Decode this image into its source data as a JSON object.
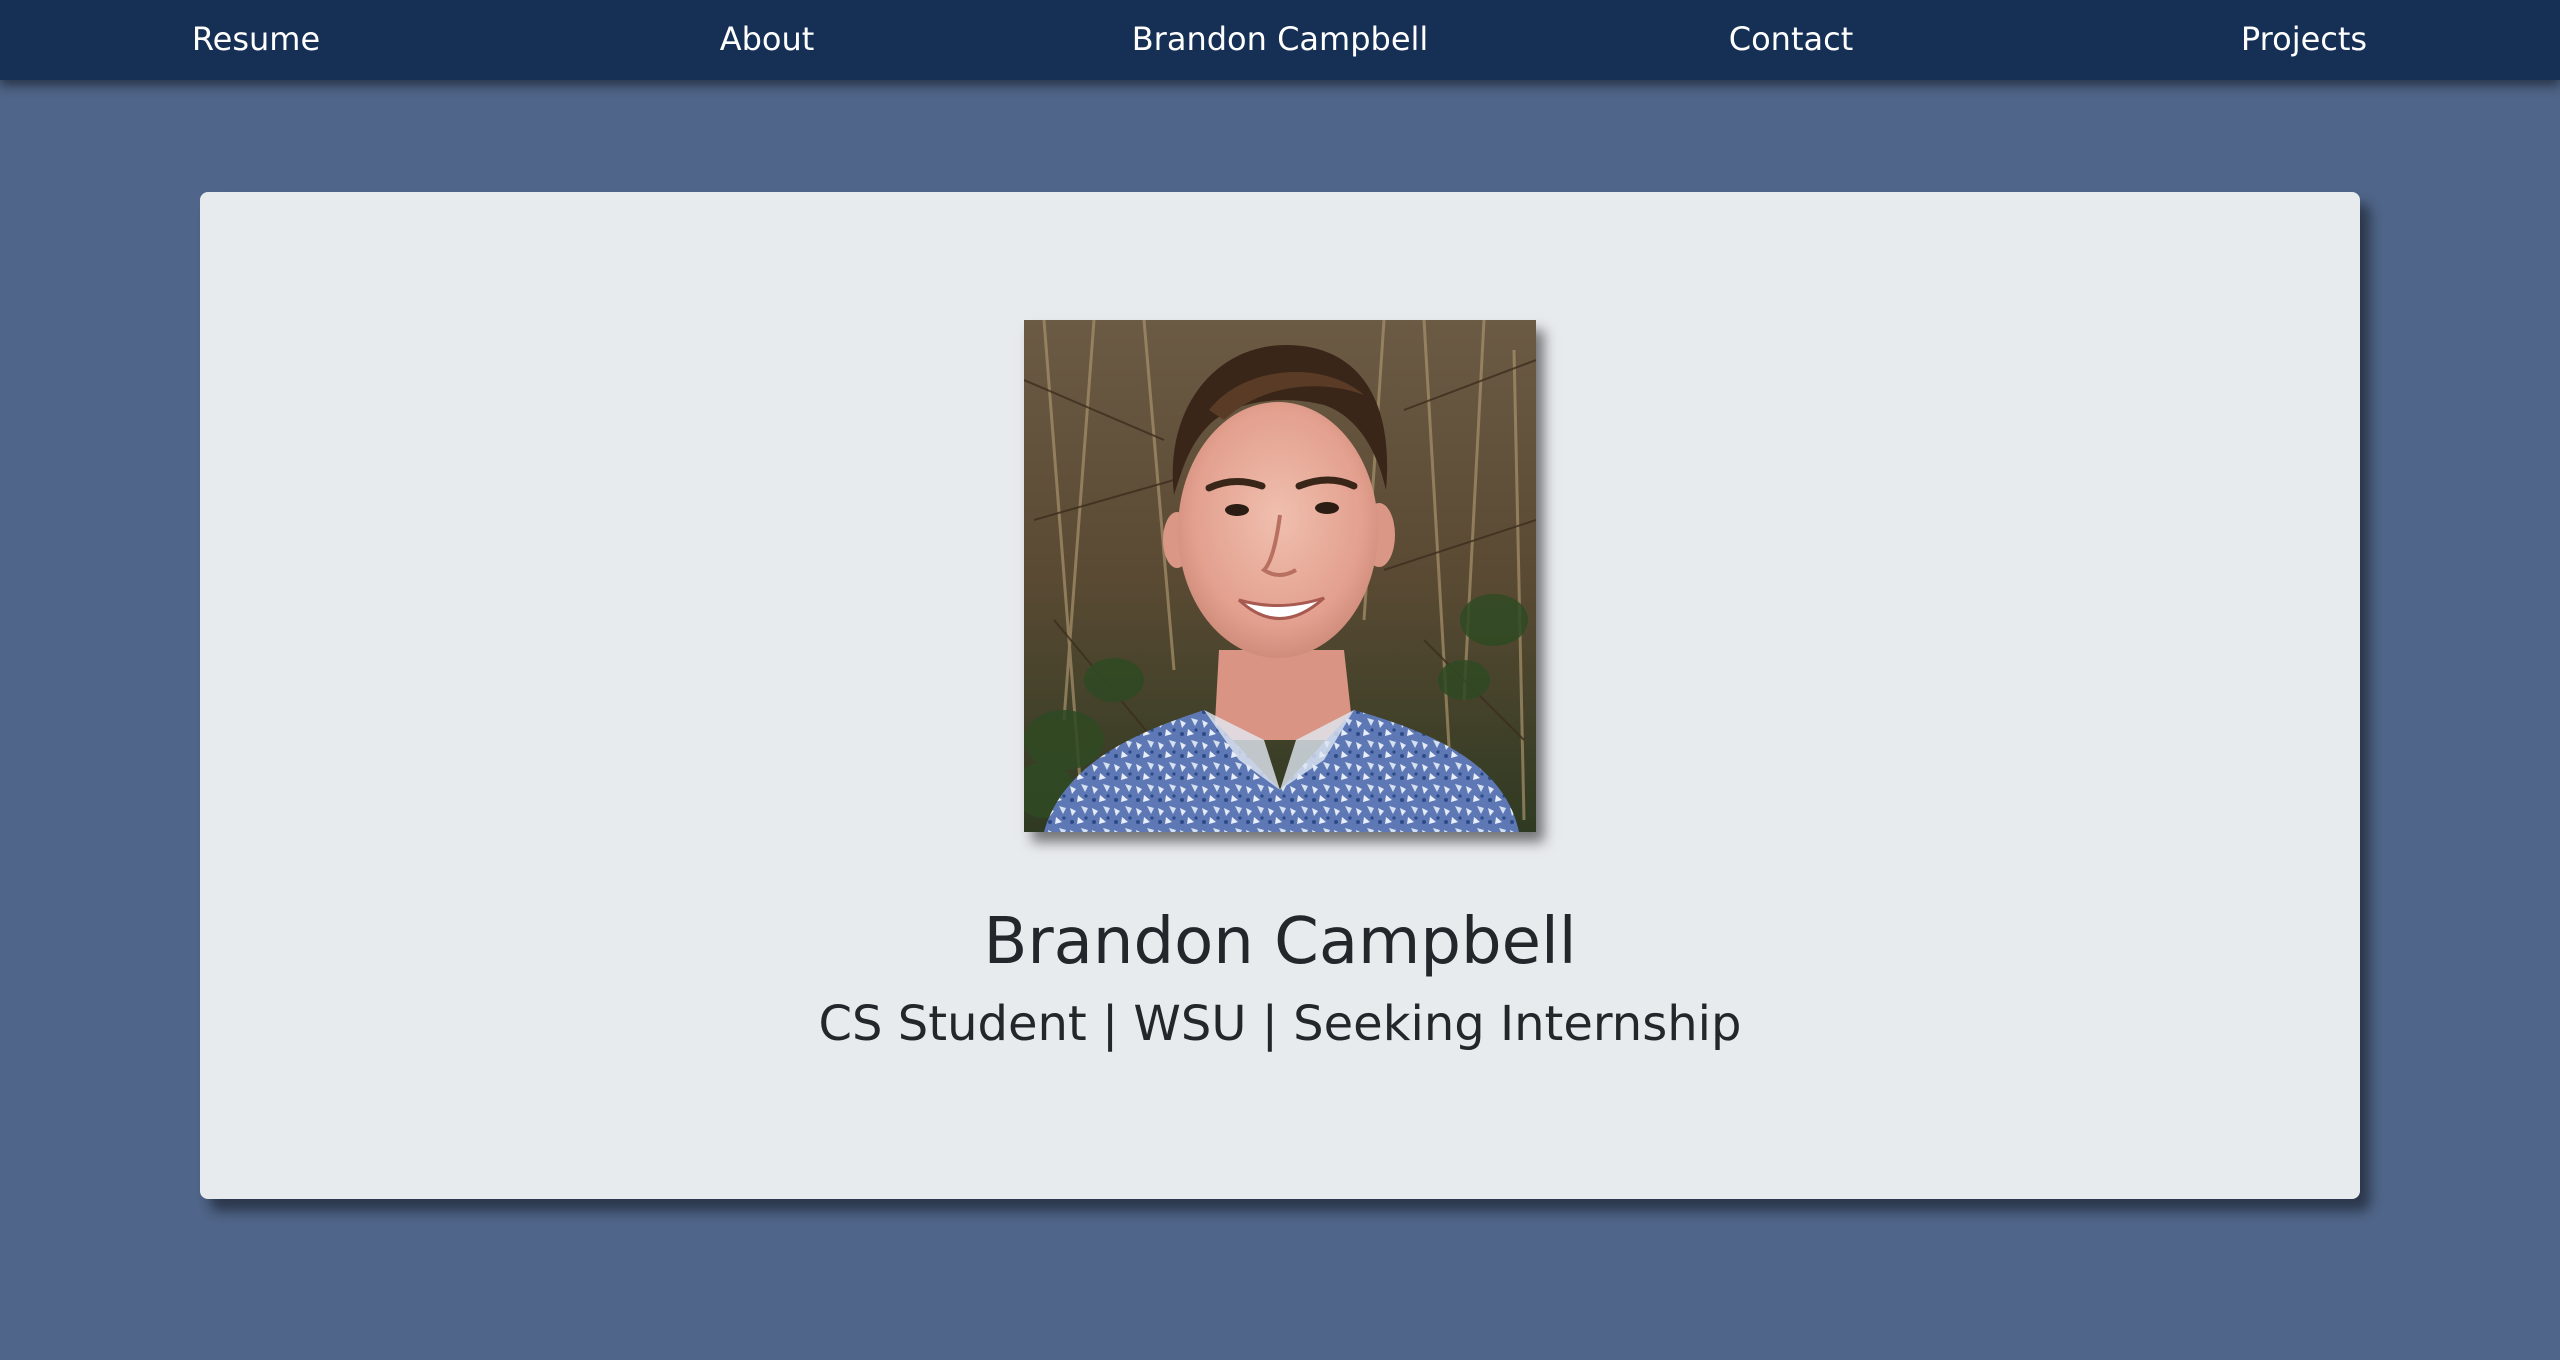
{
  "navbar": {
    "items": [
      {
        "label": "Resume"
      },
      {
        "label": "About"
      },
      {
        "label": "Brandon Campbell"
      },
      {
        "label": "Contact"
      },
      {
        "label": "Projects"
      }
    ]
  },
  "profile": {
    "name": "Brandon Campbell",
    "tagline": "CS Student | WSU | Seeking Internship"
  },
  "colors": {
    "page_background": "#4f6589",
    "navbar_background": "#162f55",
    "card_background": "#e8ebee",
    "text": "#23272c",
    "nav_text": "#ffffff"
  }
}
